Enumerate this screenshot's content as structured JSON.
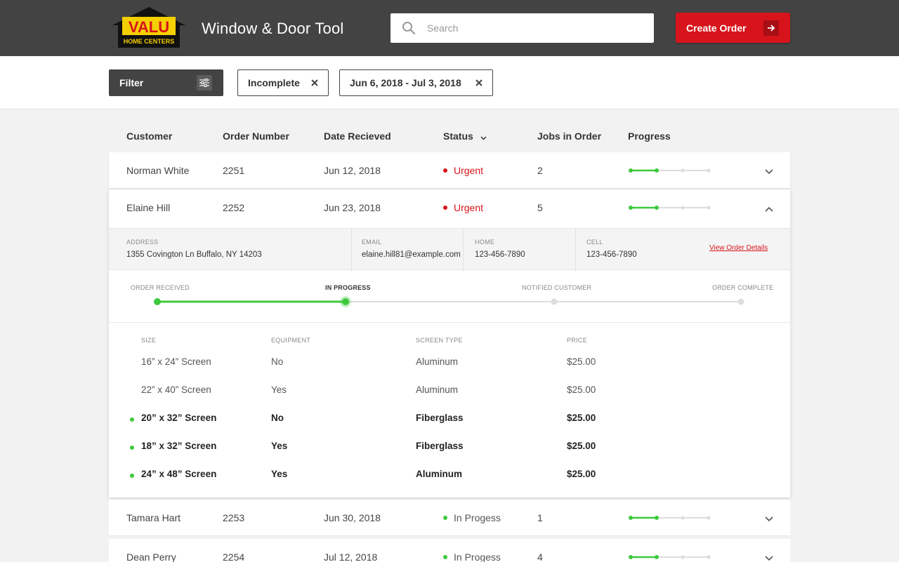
{
  "header": {
    "logo_text_top": "VALU",
    "logo_text_bottom": "HOME CENTERS",
    "title": "Window & Door Tool",
    "search_placeholder": "Search",
    "create_order_label": "Create Order"
  },
  "filters": {
    "filter_label": "Filter",
    "chips": [
      {
        "label": "Incomplete"
      },
      {
        "label": "Jun 6, 2018 - Jul 3, 2018"
      }
    ]
  },
  "table": {
    "columns": [
      "Customer",
      "Order Number",
      "Date Recieved",
      "Status",
      "Jobs in Order",
      "Progress"
    ],
    "rows": [
      {
        "customer": "Norman White",
        "order": "2251",
        "date": "Jun 12, 2018",
        "status": "Urgent",
        "jobs": "2",
        "progress_step": 2,
        "progress_total": 4
      },
      {
        "customer": "Elaine Hill",
        "order": "2252",
        "date": "Jun 23, 2018",
        "status": "Urgent",
        "jobs": "5",
        "progress_step": 2,
        "progress_total": 4
      },
      {
        "customer": "Tamara Hart",
        "order": "2253",
        "date": "Jun 30, 2018",
        "status": "In Progess",
        "jobs": "1",
        "progress_step": 2,
        "progress_total": 4
      },
      {
        "customer": "Dean Perry",
        "order": "2254",
        "date": "Jul 12, 2018",
        "status": "In Progess",
        "jobs": "4",
        "progress_step": 2,
        "progress_total": 4
      }
    ]
  },
  "expanded": {
    "contact": {
      "address_label": "ADDRESS",
      "address": "1355 Covington Ln Buffalo, NY 14203",
      "email_label": "EMAIL",
      "email": "elaine.hill81@example.com",
      "home_label": "HOME",
      "home": "123-456-7890",
      "cell_label": "CELL",
      "cell": "123-456-7890",
      "view_link": "View Order Details"
    },
    "steps": [
      "ORDER RECEIVED",
      "IN PROGRESS",
      "NOTIFIED CUSTOMER",
      "ORDER COMPLETE"
    ],
    "current_step": 2,
    "job_columns": [
      "SIZE",
      "EQUIPMENT",
      "SCREEN TYPE",
      "PRICE"
    ],
    "jobs": [
      {
        "size": "16” x 24” Screen",
        "equipment": "No",
        "screen": "Aluminum",
        "price": "$25.00",
        "active": false
      },
      {
        "size": "22” x 40” Screen",
        "equipment": "Yes",
        "screen": "Aluminum",
        "price": "$25.00",
        "active": false
      },
      {
        "size": "20” x 32” Screen",
        "equipment": "No",
        "screen": "Fiberglass",
        "price": "$25.00",
        "active": true
      },
      {
        "size": "18” x 32” Screen",
        "equipment": "Yes",
        "screen": "Fiberglass",
        "price": "$25.00",
        "active": true
      },
      {
        "size": "24” x 48” Screen",
        "equipment": "Yes",
        "screen": "Aluminum",
        "price": "$25.00",
        "active": true
      }
    ]
  },
  "colors": {
    "brand_red": "#d7141b",
    "header_dark": "#434343",
    "progress_green": "#3ec93e",
    "progress_grey": "#dddddd"
  }
}
